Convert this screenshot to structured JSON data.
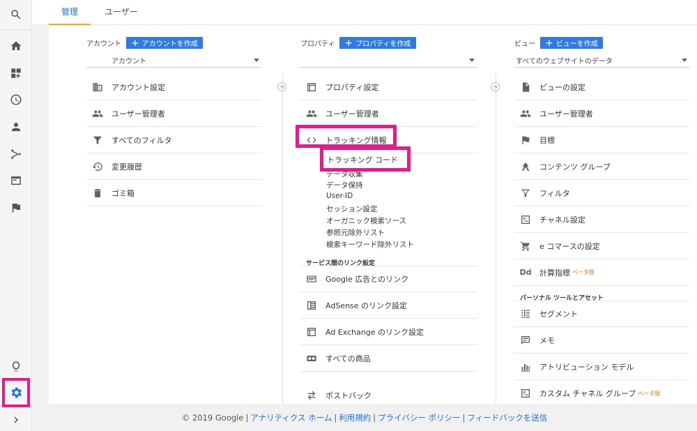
{
  "tabs": {
    "admin": "管理",
    "users": "ユーザー"
  },
  "account": {
    "label": "アカウント",
    "create_button": "アカウントを作成",
    "selected": "アカウント",
    "items": [
      {
        "label": "アカウント設定",
        "icon": "building-icon"
      },
      {
        "label": "ユーザー管理者",
        "icon": "people-icon"
      },
      {
        "label": "すべてのフィルタ",
        "icon": "filter-icon"
      },
      {
        "label": "変更履歴",
        "icon": "history-icon"
      },
      {
        "label": "ゴミ箱",
        "icon": "trash-icon"
      }
    ]
  },
  "property": {
    "label": "プロパティ",
    "create_button": "プロパティを作成",
    "selected": "",
    "items": [
      {
        "label": "プロパティ設定",
        "icon": "window-icon"
      },
      {
        "label": "ユーザー管理者",
        "icon": "people-icon"
      },
      {
        "label": "トラッキング情報",
        "icon": "code-icon"
      }
    ],
    "tracking_sub": [
      "トラッキング コード",
      "データ収集",
      "データ保持",
      "User-ID",
      "セッション設定",
      "オーガニック検索ソース",
      "参照元除外リスト",
      "検索キーワード除外リスト"
    ],
    "linking_header": "サービス間のリンク設定",
    "link_items": [
      {
        "label": "Google 広告とのリンク",
        "icon": "ads-icon"
      },
      {
        "label": "AdSense のリンク設定",
        "icon": "adsense-icon"
      },
      {
        "label": "Ad Exchange のリンク設定",
        "icon": "window-icon"
      },
      {
        "label": "すべての商品",
        "icon": "products-icon"
      },
      {
        "label": "ポストバック",
        "icon": "postback-icon"
      }
    ]
  },
  "view": {
    "label": "ビュー",
    "create_button": "ビューを作成",
    "selected": "すべてのウェブサイトのデータ",
    "items": [
      {
        "label": "ビューの設定",
        "icon": "document-icon"
      },
      {
        "label": "ユーザー管理者",
        "icon": "people-icon"
      },
      {
        "label": "目標",
        "icon": "flag-icon"
      },
      {
        "label": "コンテンツ グループ",
        "icon": "content-group-icon"
      },
      {
        "label": "フィルタ",
        "icon": "filter-icon"
      },
      {
        "label": "チャネル設定",
        "icon": "channel-icon"
      },
      {
        "label": "e コマースの設定",
        "icon": "cart-icon"
      },
      {
        "label": "計算指標",
        "icon": "dd-icon",
        "beta": "ベータ版"
      }
    ],
    "personal_header": "パーソナル ツールとアセット",
    "personal_items": [
      {
        "label": "セグメント",
        "icon": "segment-icon"
      },
      {
        "label": "メモ",
        "icon": "note-icon"
      },
      {
        "label": "アトリビューション モデル",
        "icon": "bars-icon"
      },
      {
        "label": "カスタム チャネル グループ",
        "icon": "channel-icon",
        "beta": "ベータ版"
      }
    ]
  },
  "footer": {
    "copyright": "© 2019 Google",
    "links": [
      "アナリティクス ホーム",
      "利用規約",
      "プライバシー ポリシー",
      "フィードバックを送信"
    ]
  },
  "colors": {
    "accent": "#1a73e8",
    "highlight": "#e8198b",
    "tab_underline": "#f6a623",
    "button": "#2f7ae5"
  }
}
